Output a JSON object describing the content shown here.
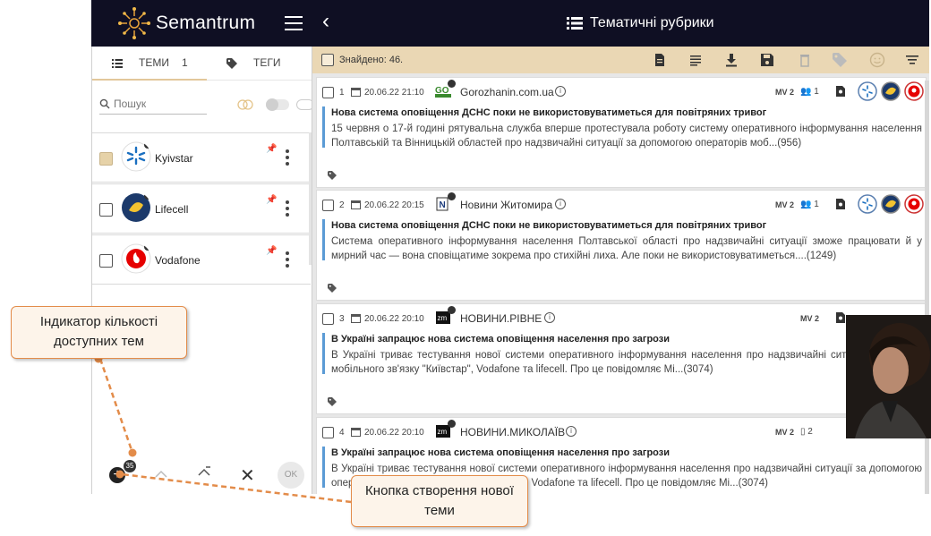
{
  "app": {
    "brand": "Semantrum",
    "page_title": "Тематичні рубрики"
  },
  "left_panel": {
    "tab_topics": "ТЕМИ",
    "tab_topics_count": "1",
    "tab_tags": "ТЕГИ",
    "search_placeholder": "Пошук",
    "topics": [
      {
        "name": "Kyivstar",
        "checked": true,
        "color": "#1a6fc0"
      },
      {
        "name": "Lifecell",
        "checked": false,
        "color": "#f2c230"
      },
      {
        "name": "Vodafone",
        "checked": false,
        "color": "#e60000"
      }
    ],
    "bottom": {
      "available_count": "35",
      "ok_label": "OK"
    }
  },
  "results": {
    "found_label": "Знайдено: 46.",
    "items": [
      {
        "num": "1",
        "datetime": "20.06.22 21:10",
        "source": "Gorozhanin.com.ua",
        "mv": "MV 2",
        "people": "1",
        "title": "Нова система оповіщення ДСНС поки не використовуватиметься для повітряних тривог",
        "snippet": "15 червня о 17-й годині рятувальна служба вперше протестувала роботу систему оперативного інформування населення Полтавській та Вінницькій областей про надзвичайні ситуації за допомогою операторів моб...(956)"
      },
      {
        "num": "2",
        "datetime": "20.06.22 20:15",
        "source": "Новини Житомира",
        "mv": "MV 2",
        "people": "1",
        "title": "Нова система оповіщення ДСНС поки не використовуватиметься для повітряних тривог",
        "snippet": "Система оперативного інформування населення Полтавської області про надзвичайні ситуації зможе працювати й у мирний час — вона сповіщатиме зокрема про стихійні лиха. Але поки не використовуватиметься....(1249)"
      },
      {
        "num": "3",
        "datetime": "20.06.22 20:10",
        "source": "НОВИНИ.РІВНЕ",
        "mv": "MV 2",
        "people": "",
        "title": "В Україні запрацює нова система оповіщення населення про загрози",
        "snippet": "В Україні триває тестування нової системи оперативного інформування населення про надзвичайні ситуаці операторів мобільного зв'язку \"Київстар\", Vodafone та lifecell. Про це повідомляє Мі...(3074)"
      },
      {
        "num": "4",
        "datetime": "20.06.22 20:10",
        "source": "НОВИНИ.МИКОЛАЇВ",
        "mv": "MV 2",
        "people": "2",
        "title": "В Україні запрацює нова система оповіщення населення про загрози",
        "snippet": "В Україні триває тестування нової системи оперативного інформування населення про надзвичайні ситуації за допомогою операторів мобільного зв'язку \"Київстар\", Vodafone та lifecell. Про це повідомляє Мі...(3074)"
      }
    ]
  },
  "callouts": {
    "topics_count": "Індикатор кількості доступних тем",
    "create_topic": "Кнопка створення нової теми"
  },
  "colors": {
    "topbar": "#0f0f23",
    "filterbar": "#ead7b4",
    "accent": "#5b9bd5",
    "callout_border": "#e38c4a"
  }
}
